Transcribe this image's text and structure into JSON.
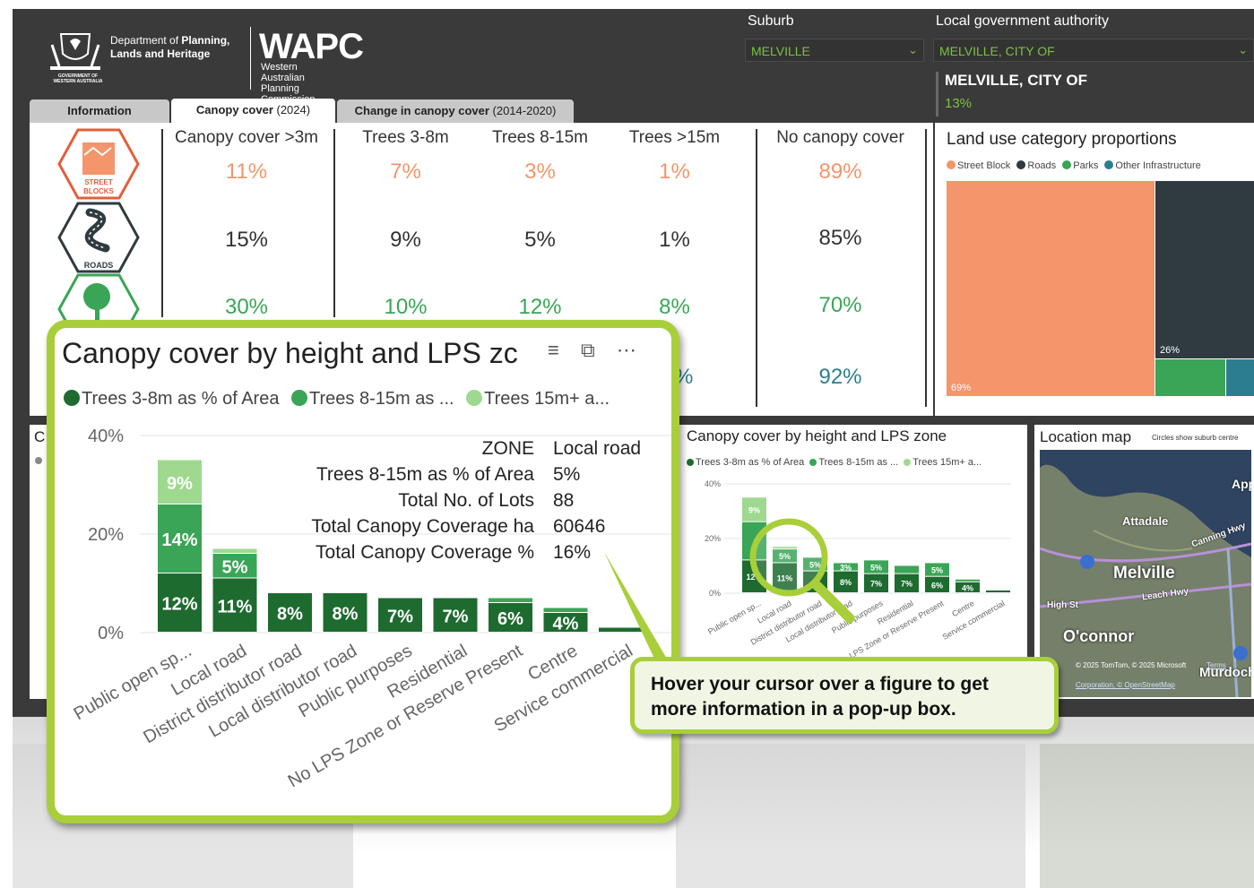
{
  "header": {
    "crest_caption": "GOVERNMENT OF WESTERN AUSTRALIA",
    "dept_line1_a": "Department of",
    "dept_line1_b": "Planning,",
    "dept_line2": "Lands and Heritage",
    "wapc": "WAPC",
    "wapc_sub1": "Western Australian",
    "wapc_sub2": "Planning Commission"
  },
  "filters": {
    "suburb_label": "Suburb",
    "suburb_value": "MELVILLE",
    "lga_label": "Local government authority",
    "lga_value": "MELVILLE, CITY OF",
    "lga_name": "MELVILLE, CITY OF",
    "lga_pct": "13%"
  },
  "tabs": [
    {
      "label": "Information",
      "suffix": ""
    },
    {
      "label": "Canopy cover",
      "suffix": " (2024)"
    },
    {
      "label": "Change in canopy cover",
      "suffix": " (2014-2020)"
    }
  ],
  "metrics": {
    "headers": [
      "Canopy cover >3m",
      "Trees 3-8m",
      "Trees 8-15m",
      "Trees >15m",
      "No canopy cover"
    ],
    "street_blocks": [
      "11%",
      "7%",
      "3%",
      "1%",
      "89%"
    ],
    "roads": [
      "15%",
      "9%",
      "5%",
      "1%",
      "85%"
    ],
    "parks": [
      "30%",
      "10%",
      "12%",
      "8%",
      "70%"
    ],
    "other_partial": [
      "%",
      "92%"
    ],
    "icon_labels": [
      "STREET BLOCKS",
      "ROADS"
    ]
  },
  "treemap": {
    "title": "Land use category proportions",
    "legend": [
      "Street Block",
      "Roads",
      "Parks",
      "Other Infrastructure"
    ],
    "colors": {
      "street": "#f4956b",
      "roads": "#2f3b40",
      "parks": "#3aa556",
      "other": "#2c7e8e"
    },
    "labels": [
      "69%",
      "26%"
    ],
    "values": {
      "street": 69,
      "roads": 26
    }
  },
  "small_chart": {
    "title": "Canopy cover by height and LPS zone",
    "legend": [
      "Trees 3-8m as % of Area",
      "Trees 8-15m as ...",
      "Trees 15m+ a..."
    ],
    "left_stub": "C"
  },
  "map": {
    "title": "Location map",
    "subtitle": "Circles show suburb centre",
    "places": [
      "Attadale",
      "Melville",
      "O'connor",
      "Apple",
      "High St",
      "Leach Hwy",
      "Canning Hwy",
      "Murdoch"
    ],
    "credit1": "© 2025 TomTom, © 2025 Microsoft",
    "credit2": "Corporation, © OpenStreetMap",
    "terms": "Terms"
  },
  "popup": {
    "title": "Canopy cover by height and LPS zc",
    "legend": [
      "Trees 3-8m as % of Area",
      "Trees 8-15m as ...",
      "Trees 15m+ a..."
    ],
    "tooltip": [
      {
        "k": "ZONE",
        "v": "Local road"
      },
      {
        "k": "Trees 8-15m as % of Area",
        "v": "5%"
      },
      {
        "k": "Total No. of Lots",
        "v": "88"
      },
      {
        "k": "Total Canopy Coverage ha",
        "v": "60646"
      },
      {
        "k": "Total Canopy Coverage %",
        "v": "16%"
      }
    ]
  },
  "callout": {
    "line1": "Hover your cursor over a figure to get",
    "line2": "more information in a pop-up box."
  },
  "chart_data": {
    "type": "bar",
    "title": "Canopy cover by height and LPS zone",
    "categories": [
      "Public open sp...",
      "Local road",
      "District distributor road",
      "Local distributor road",
      "Public purposes",
      "Residential",
      "No LPS Zone or Reserve Present",
      "Centre",
      "Service commercial"
    ],
    "series": [
      {
        "name": "Trees 3-8m as % of Area",
        "color": "#1e6b30",
        "values": [
          12,
          11,
          8,
          8,
          7,
          7,
          6,
          4,
          1
        ]
      },
      {
        "name": "Trees 8-15m as ...",
        "color": "#3aa556",
        "values": [
          14,
          5,
          0,
          0,
          0,
          0,
          1,
          1,
          0
        ]
      },
      {
        "name": "Trees 15m+ a...",
        "color": "#9fd98f",
        "values": [
          9,
          1,
          0,
          0,
          0,
          0,
          0,
          0,
          0
        ]
      }
    ],
    "labels": [
      [
        "12%",
        "14%",
        "9%"
      ],
      [
        "11%",
        "5%",
        ""
      ],
      [
        "8%",
        "",
        ""
      ],
      [
        "8%",
        "",
        ""
      ],
      [
        "7%",
        "",
        ""
      ],
      [
        "7%",
        "",
        ""
      ],
      [
        "6%",
        "5%",
        ""
      ],
      [
        "4%",
        "",
        ""
      ],
      [
        "",
        "",
        ""
      ]
    ],
    "yticks": [
      "0%",
      "20%",
      "40%"
    ],
    "ylim": [
      0,
      40
    ],
    "small_labels": [
      [
        "12%",
        "",
        "9%"
      ],
      [
        "11%",
        "5%",
        ""
      ],
      [
        "",
        "5%",
        ""
      ],
      [
        "8%",
        "3%",
        ""
      ],
      [
        "7%",
        "5%",
        ""
      ],
      [
        "7%",
        "",
        ""
      ],
      [
        "6%",
        "5%",
        ""
      ],
      [
        "4%",
        "",
        ""
      ],
      [
        "",
        "",
        ""
      ]
    ],
    "small_series": [
      [
        12,
        11,
        8,
        8,
        7,
        7,
        6,
        4,
        1
      ],
      [
        14,
        5,
        5,
        3,
        5,
        3,
        5,
        1,
        0
      ],
      [
        9,
        1,
        0,
        0,
        0,
        0,
        0,
        0,
        0
      ]
    ],
    "small_yticks": [
      "0%",
      "20%",
      "40%"
    ]
  }
}
